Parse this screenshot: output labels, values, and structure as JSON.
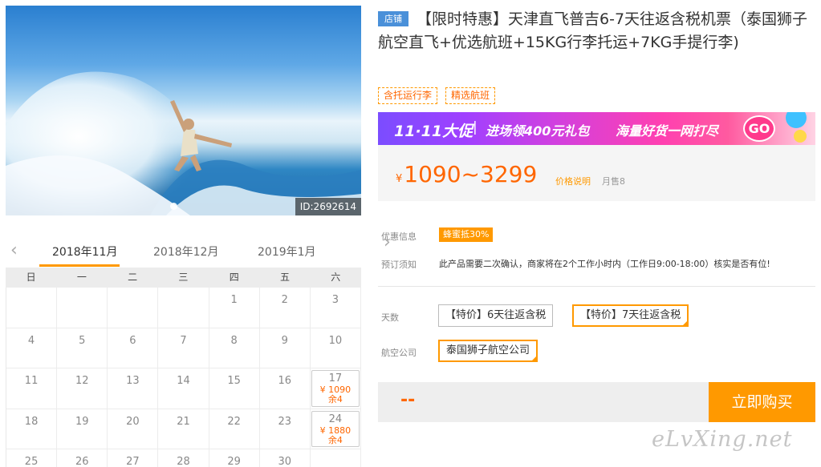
{
  "hero": {
    "image_id": "ID:2692614"
  },
  "calendar": {
    "months": [
      "2018年11月",
      "2018年12月",
      "2019年1月"
    ],
    "active_month": "2018年11月",
    "weekdays": [
      "日",
      "一",
      "二",
      "三",
      "四",
      "五",
      "六"
    ],
    "rows": [
      [
        {
          "day": ""
        },
        {
          "day": ""
        },
        {
          "day": ""
        },
        {
          "day": ""
        },
        {
          "day": "1"
        },
        {
          "day": "2"
        },
        {
          "day": "3"
        }
      ],
      [
        {
          "day": "4"
        },
        {
          "day": "5"
        },
        {
          "day": "6"
        },
        {
          "day": "7"
        },
        {
          "day": "8"
        },
        {
          "day": "9"
        },
        {
          "day": "10"
        }
      ],
      [
        {
          "day": "11"
        },
        {
          "day": "12"
        },
        {
          "day": "13"
        },
        {
          "day": "14"
        },
        {
          "day": "15"
        },
        {
          "day": "16"
        },
        {
          "day": "17",
          "price": "¥ 1090",
          "remain": "余4"
        }
      ],
      [
        {
          "day": "18"
        },
        {
          "day": "19"
        },
        {
          "day": "20"
        },
        {
          "day": "21"
        },
        {
          "day": "22"
        },
        {
          "day": "23"
        },
        {
          "day": "24",
          "price": "¥ 1880",
          "remain": "余4"
        }
      ],
      [
        {
          "day": "25"
        },
        {
          "day": "26"
        },
        {
          "day": "27"
        },
        {
          "day": "28"
        },
        {
          "day": "29"
        },
        {
          "day": "30"
        },
        {
          "day": ""
        }
      ]
    ]
  },
  "product": {
    "shop_badge": "店铺",
    "title": "【限时特惠】天津直飞普吉6-7天往返含税机票（泰国狮子航空直飞+优选航班+15KG行李托运+7KG手提行李)",
    "tags": [
      "含托运行李",
      "精选航班"
    ]
  },
  "banner": {
    "part1": "11·11大促",
    "sep": "|",
    "part2": "进场领400元礼包",
    "part3": "海量好货一网打尽",
    "go": "GO"
  },
  "price": {
    "symbol": "¥",
    "range": "1090~3299",
    "explain": "价格说明",
    "sold": "月售8"
  },
  "info": {
    "promo_label": "优惠信息",
    "promo_badge": "蜂蜜抵30%",
    "notice_label": "预订须知",
    "notice_text": "此产品需要二次确认，商家将在2个工作小时内（工作日9:00-18:00）核实是否有位!"
  },
  "options": {
    "days_label": "天数",
    "days": [
      "【特价】6天往返含税",
      "【特价】7天往返含税"
    ],
    "airline_label": "航空公司",
    "airline": "泰国狮子航空公司"
  },
  "buy": {
    "placeholder_price": "--",
    "button": "立即购买"
  },
  "watermark": "eLvXing.net"
}
